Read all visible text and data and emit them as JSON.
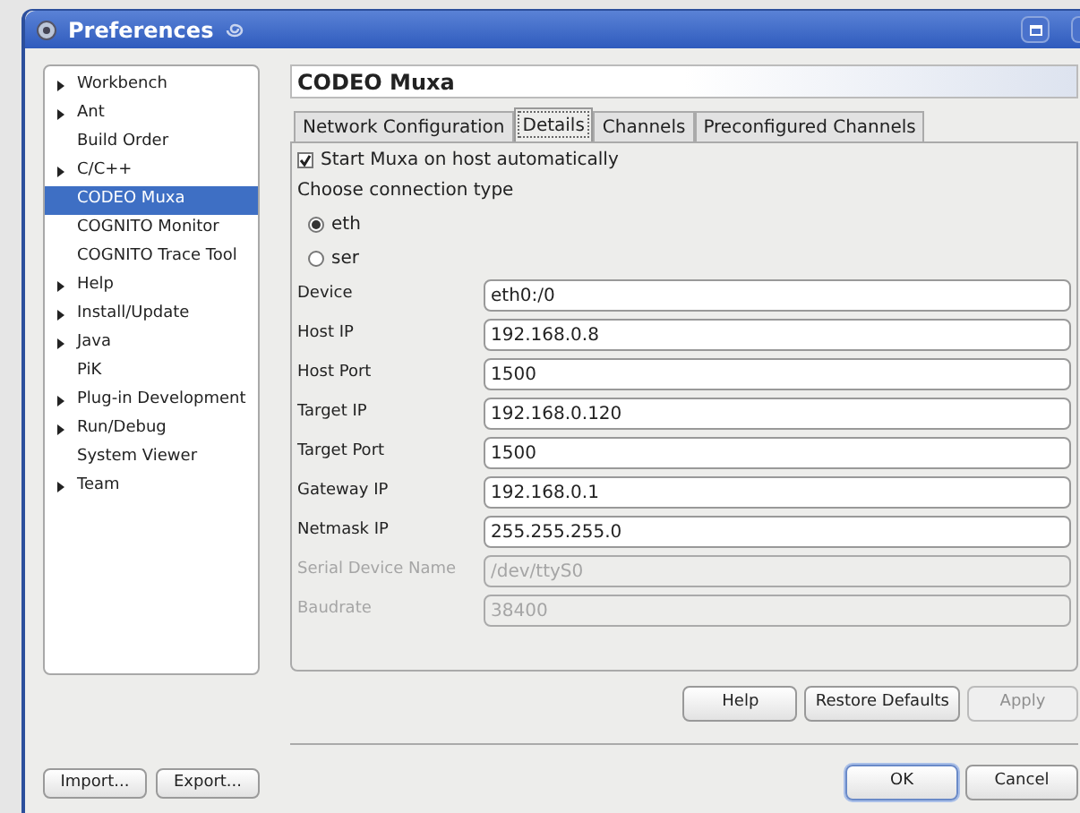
{
  "window": {
    "title": "Preferences"
  },
  "sidebar": {
    "items": [
      {
        "label": "Workbench",
        "expandable": true,
        "selected": false
      },
      {
        "label": "Ant",
        "expandable": true,
        "selected": false
      },
      {
        "label": "Build Order",
        "expandable": false,
        "selected": false
      },
      {
        "label": "C/C++",
        "expandable": true,
        "selected": false
      },
      {
        "label": "CODEO Muxa",
        "expandable": false,
        "selected": true
      },
      {
        "label": "COGNITO Monitor",
        "expandable": false,
        "selected": false
      },
      {
        "label": "COGNITO Trace Tool",
        "expandable": false,
        "selected": false
      },
      {
        "label": "Help",
        "expandable": true,
        "selected": false
      },
      {
        "label": "Install/Update",
        "expandable": true,
        "selected": false
      },
      {
        "label": "Java",
        "expandable": true,
        "selected": false
      },
      {
        "label": "PiK",
        "expandable": false,
        "selected": false
      },
      {
        "label": "Plug-in Development",
        "expandable": true,
        "selected": false
      },
      {
        "label": "Run/Debug",
        "expandable": true,
        "selected": false
      },
      {
        "label": "System Viewer",
        "expandable": false,
        "selected": false
      },
      {
        "label": "Team",
        "expandable": true,
        "selected": false
      }
    ]
  },
  "page_title": "CODEO Muxa",
  "tabs": [
    {
      "label": "Network Configuration",
      "selected": false
    },
    {
      "label": "Details",
      "selected": true
    },
    {
      "label": "Channels",
      "selected": false
    },
    {
      "label": "Preconfigured Channels",
      "selected": false
    }
  ],
  "auto_start": {
    "label": "Start Muxa on host automatically",
    "checked": true
  },
  "connection_type": {
    "label": "Choose connection type",
    "options": [
      {
        "label": "eth",
        "selected": true
      },
      {
        "label": "ser",
        "selected": false
      }
    ]
  },
  "fields": [
    {
      "label": "Device",
      "value": "eth0:/0",
      "disabled": false
    },
    {
      "label": "Host IP",
      "value": "192.168.0.8",
      "disabled": false
    },
    {
      "label": "Host Port",
      "value": "1500",
      "disabled": false
    },
    {
      "label": "Target IP",
      "value": "192.168.0.120",
      "disabled": false
    },
    {
      "label": "Target Port",
      "value": "1500",
      "disabled": false
    },
    {
      "label": "Gateway IP",
      "value": "192.168.0.1",
      "disabled": false
    },
    {
      "label": "Netmask IP",
      "value": "255.255.255.0",
      "disabled": false
    },
    {
      "label": "Serial Device Name",
      "value": "/dev/ttyS0",
      "disabled": true
    },
    {
      "label": "Baudrate",
      "value": "38400",
      "disabled": true
    }
  ],
  "page_buttons": [
    {
      "label": "Help",
      "disabled": false
    },
    {
      "label": "Restore Defaults",
      "disabled": false
    },
    {
      "label": "Apply",
      "disabled": true
    }
  ],
  "left_buttons": [
    {
      "label": "Import..."
    },
    {
      "label": "Export..."
    }
  ],
  "dialog_buttons": [
    {
      "label": "OK",
      "default": true
    },
    {
      "label": "Cancel",
      "default": false
    }
  ]
}
